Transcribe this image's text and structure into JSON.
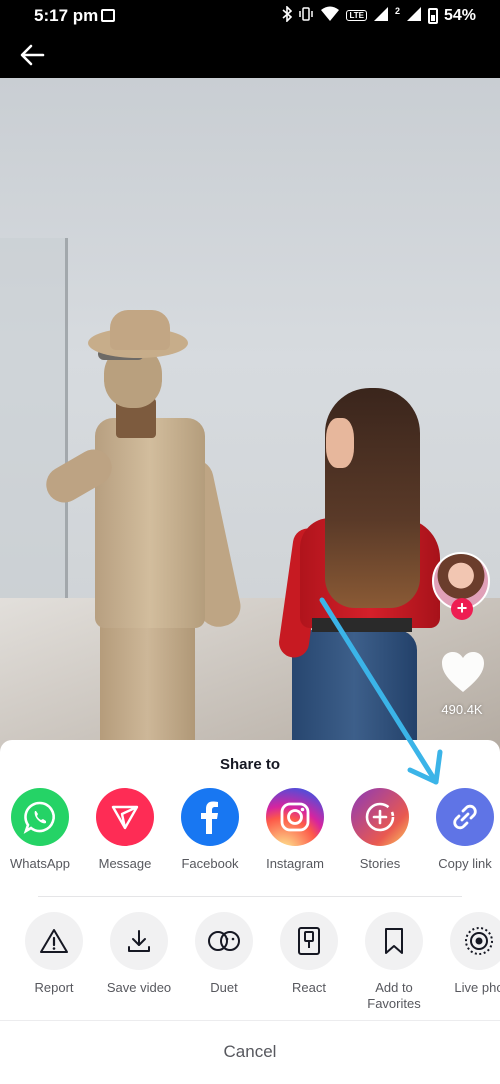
{
  "status_bar": {
    "time": "5:17 pm",
    "battery": "54%",
    "icons": [
      "gallery-icon",
      "bluetooth-icon",
      "vibrate-icon",
      "wifi-icon",
      "volte-icon",
      "signal-icon",
      "signal-2-icon",
      "battery-icon"
    ],
    "volte_label": "LTE",
    "sim2_label": "2"
  },
  "header": {
    "back_icon": "back-arrow-icon"
  },
  "video": {
    "like_count": "490.4K",
    "follow_plus": "+"
  },
  "share_sheet": {
    "title": "Share to",
    "share_targets": [
      {
        "label": "WhatsApp",
        "icon": "whatsapp-icon",
        "color": "#25D366"
      },
      {
        "label": "Message",
        "icon": "message-icon",
        "color": "#FE2C55"
      },
      {
        "label": "Facebook",
        "icon": "facebook-icon",
        "color": "#1877F2"
      },
      {
        "label": "Instagram",
        "icon": "instagram-icon",
        "color": "#D6249F"
      },
      {
        "label": "Stories",
        "icon": "stories-icon",
        "color": "#8A3AB9"
      },
      {
        "label": "Copy link",
        "icon": "copy-link-icon",
        "color": "#5F74E6"
      }
    ],
    "actions": [
      {
        "label": "Report",
        "icon": "report-icon"
      },
      {
        "label": "Save video",
        "icon": "download-icon"
      },
      {
        "label": "Duet",
        "icon": "duet-icon"
      },
      {
        "label": "React",
        "icon": "react-icon"
      },
      {
        "label_line1": "Add to",
        "label_line2": "Favorites",
        "icon": "bookmark-icon"
      },
      {
        "label": "Live pho",
        "icon": "live-photo-icon"
      }
    ],
    "cancel_label": "Cancel"
  },
  "colors": {
    "accent_red": "#FE2C55",
    "annotation_arrow": "#3BB4E8"
  }
}
